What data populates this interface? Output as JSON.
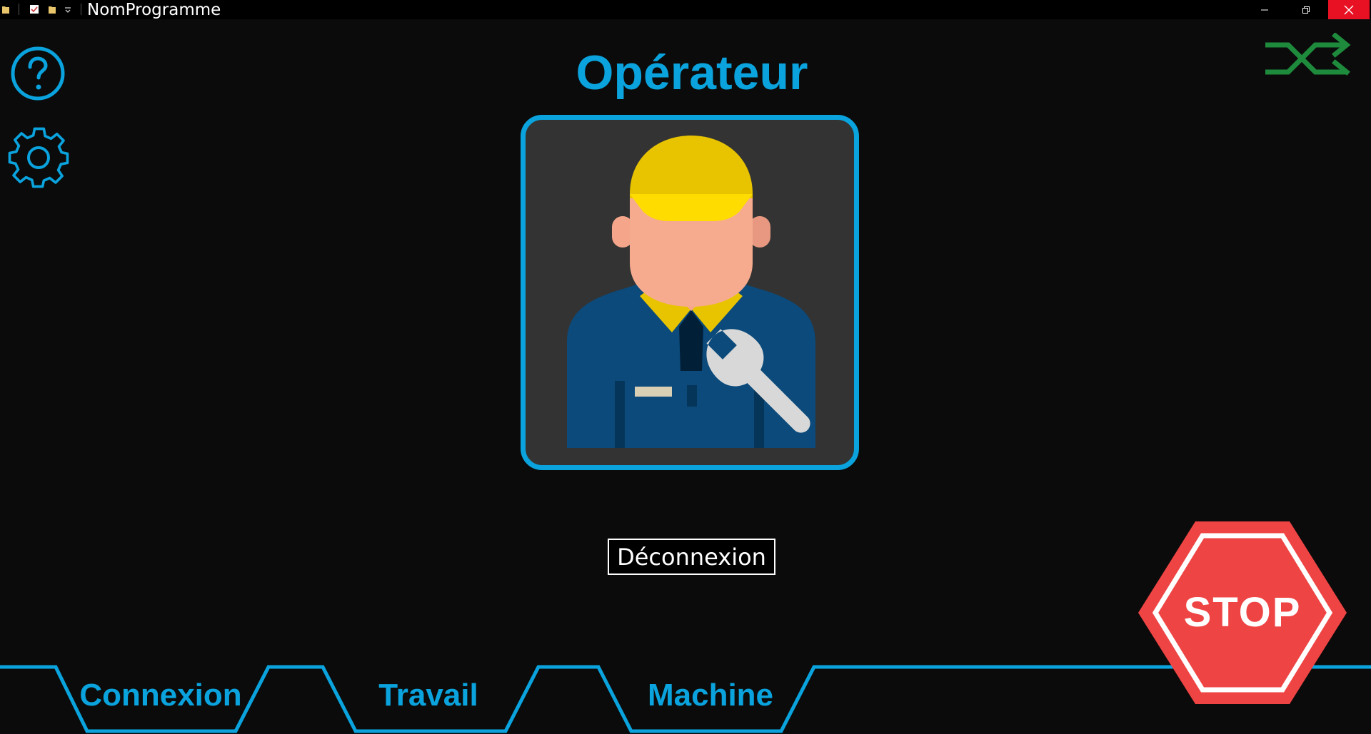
{
  "window": {
    "title": "NomProgramme",
    "close_color": "#e81123"
  },
  "colors": {
    "accent": "#0aa3dd",
    "switch": "#1e8a3c",
    "stop": "#ef4444",
    "background": "#0b0b0b"
  },
  "page": {
    "title": "Opérateur",
    "avatar_icon": "mechanic-worker-avatar",
    "logout_label": "Déconnexion"
  },
  "sidebar": {
    "help_icon": "question-circle-icon",
    "settings_icon": "gear-icon"
  },
  "header": {
    "switch_user_icon": "shuffle-arrows-icon"
  },
  "tabs": [
    {
      "label": "Connexion"
    },
    {
      "label": "Travail"
    },
    {
      "label": "Machine"
    }
  ],
  "stop_button": {
    "label": "STOP"
  }
}
